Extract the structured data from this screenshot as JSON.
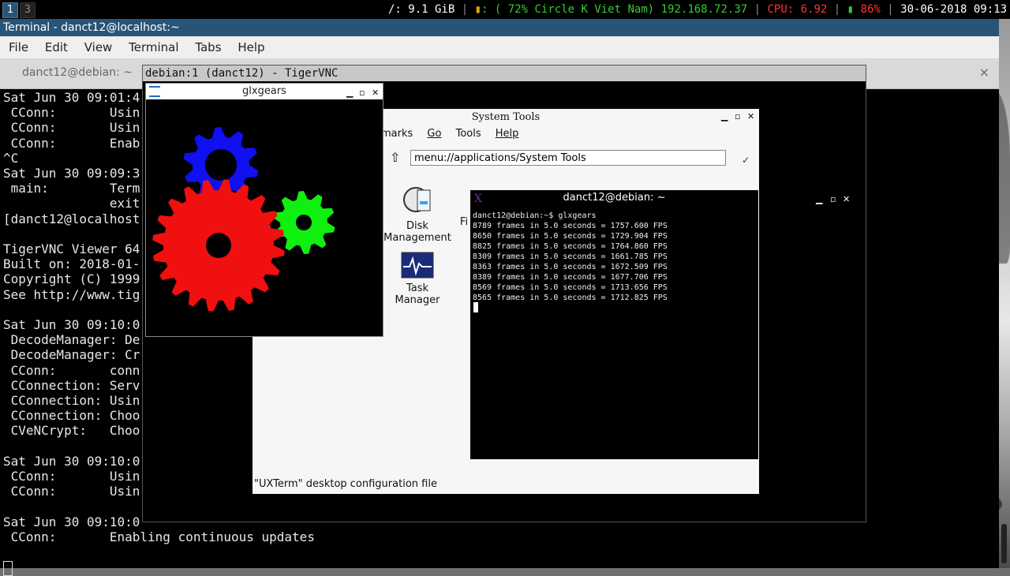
{
  "topbar": {
    "workspaces": [
      "1",
      "3"
    ],
    "disk": "/: 9.1 GiB",
    "wifi": ": ( 72% Circle K Viet Nam) 192.168.72.37",
    "cpu": "CPU: 6.92",
    "battery": " 86%",
    "datetime": "30-06-2018 09:13",
    "colors": {
      "wifi": "#33cc33",
      "cpu": "#ff3333",
      "battery": "#ff3333"
    }
  },
  "terminal": {
    "title": "Terminal - danct12@localhost:~",
    "menu": [
      "File",
      "Edit",
      "View",
      "Terminal",
      "Tabs",
      "Help"
    ],
    "tab_label": "danct12@debian: ~",
    "tab_close": "×",
    "lines": [
      "Sat Jun 30 09:01:4",
      " CConn:       Usin",
      " CConn:       Usin",
      " CConn:       Enab",
      "^C",
      "Sat Jun 30 09:09:3",
      " main:        Term",
      "              exit",
      "[danct12@localhost",
      "",
      "TigerVNC Viewer 64",
      "Built on: 2018-01-",
      "Copyright (C) 1999",
      "See http://www.tig",
      "",
      "Sat Jun 30 09:10:0",
      " DecodeManager: De",
      " DecodeManager: Cr",
      " CConn:       conn",
      " CConnection: Serv",
      " CConnection: Usin",
      " CConnection: Choo",
      " CVeNCrypt:   Choo",
      "",
      "Sat Jun 30 09:10:0",
      " CConn:       Usin",
      " CConn:       Usin",
      "",
      "Sat Jun 30 09:10:0",
      " CConn:       Enabling continuous updates"
    ]
  },
  "vnc": {
    "title": "debian:1 (danct12) - TigerVNC"
  },
  "file_manager": {
    "title": "System Tools",
    "menu": [
      "marks",
      "Go",
      "Tools",
      "Help"
    ],
    "location": "menu://applications/System Tools",
    "icons": [
      {
        "label": "Disk Management",
        "icon": "disk-icon"
      },
      {
        "label": "Fi",
        "icon": "file-icon"
      },
      {
        "label": "Task Manager",
        "icon": "task-manager-icon"
      }
    ],
    "status": "\"UXTerm\" desktop configuration file"
  },
  "glxgears": {
    "title": "glxgears"
  },
  "uxterm": {
    "title": "danct12@debian: ~",
    "prompt": "danct12@debian:~$ glxgears",
    "output": [
      "8789 frames in 5.0 seconds = 1757.600 FPS",
      "8650 frames in 5.0 seconds = 1729.904 FPS",
      "8825 frames in 5.0 seconds = 1764.860 FPS",
      "8309 frames in 5.0 seconds = 1661.785 FPS",
      "8363 frames in 5.0 seconds = 1672.509 FPS",
      "8389 frames in 5.0 seconds = 1677.706 FPS",
      "8569 frames in 5.0 seconds = 1713.656 FPS",
      "8565 frames in 5.0 seconds = 1712.825 FPS"
    ]
  }
}
